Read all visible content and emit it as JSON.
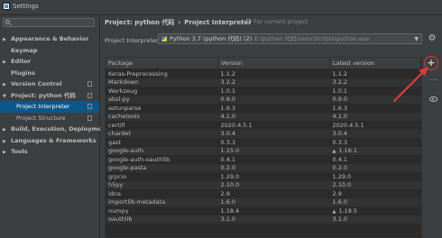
{
  "window": {
    "title": "Settings"
  },
  "sidebar": {
    "search_placeholder": "Q-",
    "items": [
      {
        "label": "Appearance & Behavior",
        "arrow": "▶",
        "bold": true,
        "sub": false,
        "selected": false,
        "page": false
      },
      {
        "label": "Keymap",
        "arrow": "",
        "bold": true,
        "sub": false,
        "selected": false,
        "page": false
      },
      {
        "label": "Editor",
        "arrow": "▶",
        "bold": true,
        "sub": false,
        "selected": false,
        "page": false
      },
      {
        "label": "Plugins",
        "arrow": "",
        "bold": true,
        "sub": false,
        "selected": false,
        "page": false
      },
      {
        "label": "Version Control",
        "arrow": "▶",
        "bold": true,
        "sub": false,
        "selected": false,
        "page": true
      },
      {
        "label": "Project: python 代码",
        "arrow": "▼",
        "bold": true,
        "sub": false,
        "selected": false,
        "page": true
      },
      {
        "label": "Project Interpreter",
        "arrow": "",
        "bold": false,
        "sub": true,
        "selected": true,
        "page": true
      },
      {
        "label": "Project Structure",
        "arrow": "",
        "bold": false,
        "sub": true,
        "selected": false,
        "page": true
      },
      {
        "label": "Build, Execution, Deployment",
        "arrow": "▶",
        "bold": true,
        "sub": false,
        "selected": false,
        "page": false
      },
      {
        "label": "Languages & Frameworks",
        "arrow": "▶",
        "bold": true,
        "sub": false,
        "selected": false,
        "page": false
      },
      {
        "label": "Tools",
        "arrow": "▶",
        "bold": true,
        "sub": false,
        "selected": false,
        "page": false
      }
    ]
  },
  "breadcrumb": {
    "project": "Project: python 代码",
    "separator": "›",
    "page": "Project Interpreter",
    "scope": "For current project"
  },
  "interpreter": {
    "label": "Project Interpreter:",
    "name": "Python 3.7 (python 代码) (2)",
    "path": "E:\\python 代码\\venv\\Scripts\\python.exe",
    "dropdown_icon": "chevron-down-icon",
    "settings_icon": "gear-icon"
  },
  "packages": {
    "columns": [
      "Package",
      "Version",
      "Latest version"
    ],
    "rows": [
      [
        "Keras-Preprocessing",
        "1.1.2",
        "1.1.2",
        false
      ],
      [
        "Markdown",
        "3.2.2",
        "3.2.2",
        false
      ],
      [
        "Werkzeug",
        "1.0.1",
        "1.0.1",
        false
      ],
      [
        "absl-py",
        "0.9.0",
        "0.9.0",
        false
      ],
      [
        "astunparse",
        "1.6.3",
        "1.6.3",
        false
      ],
      [
        "cachetools",
        "4.1.0",
        "4.1.0",
        false
      ],
      [
        "certifi",
        "2020.4.5.1",
        "2020.4.5.1",
        false
      ],
      [
        "chardet",
        "3.0.4",
        "3.0.4",
        false
      ],
      [
        "gast",
        "0.3.3",
        "0.3.3",
        false
      ],
      [
        "google-auth",
        "1.15.0",
        "1.16.1",
        true
      ],
      [
        "google-auth-oauthlib",
        "0.4.1",
        "0.4.1",
        false
      ],
      [
        "google-pasta",
        "0.2.0",
        "0.2.0",
        false
      ],
      [
        "grpcio",
        "1.29.0",
        "1.29.0",
        false
      ],
      [
        "h5py",
        "2.10.0",
        "2.10.0",
        false
      ],
      [
        "idna",
        "2.9",
        "2.9",
        false
      ],
      [
        "importlib-metadata",
        "1.6.0",
        "1.6.0",
        false
      ],
      [
        "numpy",
        "1.18.4",
        "1.18.5",
        true
      ],
      [
        "oauthlib",
        "3.1.0",
        "3.1.0",
        false
      ]
    ]
  },
  "toolbar": {
    "add_icon": "plus-icon",
    "remove_icon": "minus-icon",
    "show_early_releases_icon": "eye-icon"
  },
  "annotation": {
    "color": "#e53935"
  },
  "colors": {
    "background": "#3c3f41",
    "table_bg": "#2b2b2b",
    "selection": "#0d5689"
  }
}
